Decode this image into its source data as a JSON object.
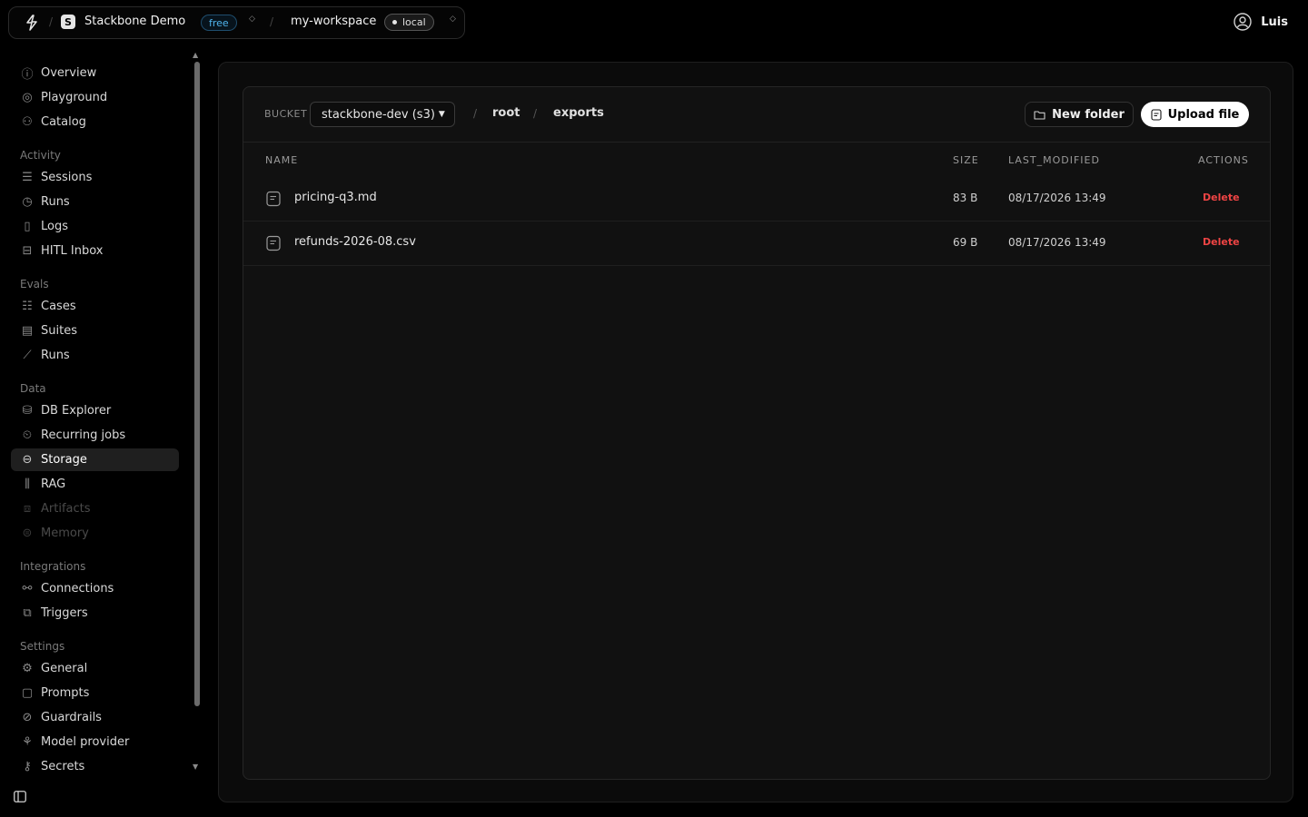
{
  "topbar": {
    "org_initial": "S",
    "org_name": "Stackbone Demo",
    "plan_badge": "free",
    "workspace_name": "my-workspace",
    "env_badge": "local",
    "separator": "/"
  },
  "user": {
    "name": "Luis"
  },
  "sidebar": {
    "top_items": [
      {
        "label": "Overview",
        "icon": "info-icon"
      },
      {
        "label": "Playground",
        "icon": "play-icon"
      },
      {
        "label": "Catalog",
        "icon": "users-icon"
      }
    ],
    "sections": [
      {
        "title": "Activity",
        "items": [
          {
            "label": "Sessions",
            "icon": "list-icon"
          },
          {
            "label": "Runs",
            "icon": "clock-icon"
          },
          {
            "label": "Logs",
            "icon": "doc-icon"
          },
          {
            "label": "HITL Inbox",
            "icon": "inbox-icon"
          }
        ]
      },
      {
        "title": "Evals",
        "items": [
          {
            "label": "Cases",
            "icon": "checklist-icon"
          },
          {
            "label": "Suites",
            "icon": "stack-icon"
          },
          {
            "label": "Runs",
            "icon": "chart-icon"
          }
        ]
      },
      {
        "title": "Data",
        "items": [
          {
            "label": "DB Explorer",
            "icon": "database-icon"
          },
          {
            "label": "Recurring jobs",
            "icon": "alarm-icon"
          },
          {
            "label": "Storage",
            "icon": "drive-icon",
            "active": true
          },
          {
            "label": "RAG",
            "icon": "books-icon"
          },
          {
            "label": "Artifacts",
            "icon": "box-icon",
            "disabled": true
          },
          {
            "label": "Memory",
            "icon": "memory-icon",
            "disabled": true
          }
        ]
      },
      {
        "title": "Integrations",
        "items": [
          {
            "label": "Connections",
            "icon": "plug-icon"
          },
          {
            "label": "Triggers",
            "icon": "trigger-icon"
          }
        ]
      },
      {
        "title": "Settings",
        "items": [
          {
            "label": "General",
            "icon": "gear-icon"
          },
          {
            "label": "Prompts",
            "icon": "message-icon"
          },
          {
            "label": "Guardrails",
            "icon": "shield-icon"
          },
          {
            "label": "Model provider",
            "icon": "model-icon"
          },
          {
            "label": "Secrets",
            "icon": "key-icon"
          }
        ]
      }
    ]
  },
  "storage": {
    "bucket_label": "BUCKET",
    "bucket_value": "stackbone-dev (s3)",
    "breadcrumb": [
      "root",
      "exports"
    ],
    "crumb_separator": "/",
    "new_folder_label": "New folder",
    "upload_label": "Upload file",
    "columns": {
      "name": "NAME",
      "size": "SIZE",
      "modified": "LAST_MODIFIED",
      "actions": "ACTIONS"
    },
    "files": [
      {
        "name": "pricing-q3.md",
        "size": "83 B",
        "modified": "08/17/2026 13:49",
        "action": "Delete"
      },
      {
        "name": "refunds-2026-08.csv",
        "size": "69 B",
        "modified": "08/17/2026 13:49",
        "action": "Delete"
      }
    ]
  },
  "colors": {
    "accent_delete": "#ef4444",
    "badge_free": "#4fb3ec",
    "active_bg": "#1f1f1f"
  }
}
